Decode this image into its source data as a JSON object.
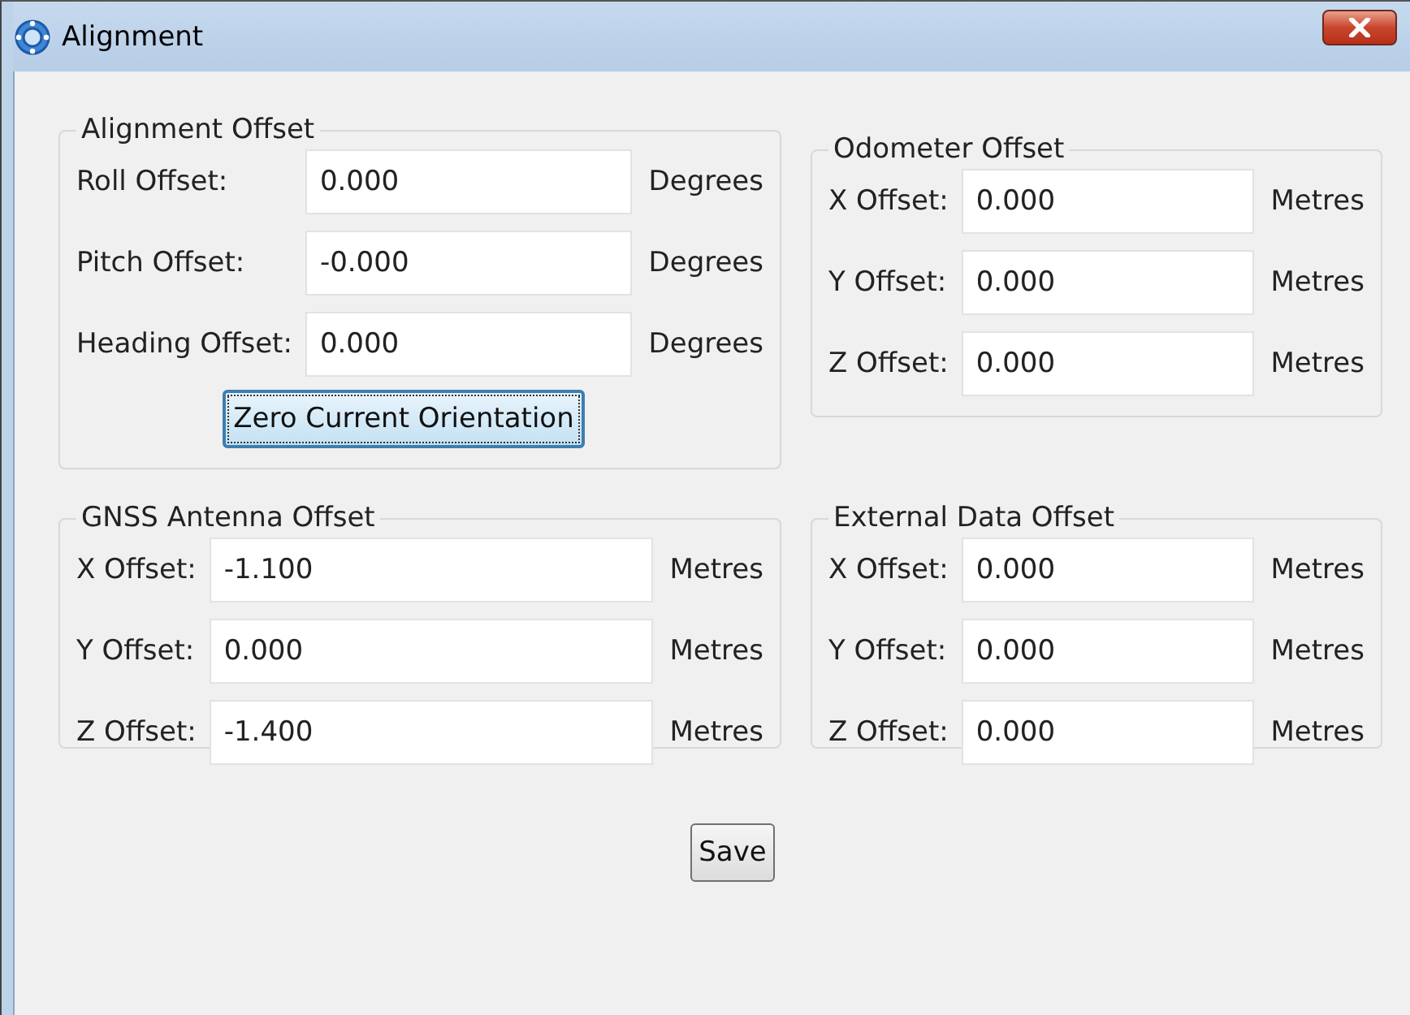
{
  "window": {
    "title": "Alignment"
  },
  "groups": [
    {
      "title": "Alignment Offset",
      "fields": [
        {
          "label": "Roll Offset:",
          "value": "0.000",
          "unit": "Degrees"
        },
        {
          "label": "Pitch Offset:",
          "value": "-0.000",
          "unit": "Degrees"
        },
        {
          "label": "Heading Offset:",
          "value": "0.000",
          "unit": "Degrees"
        }
      ],
      "button": {
        "label": "Zero Current Orientation",
        "focused": true
      }
    },
    {
      "title": "Odometer Offset",
      "fields": [
        {
          "label": "X Offset:",
          "value": "0.000",
          "unit": "Metres"
        },
        {
          "label": "Y Offset:",
          "value": "0.000",
          "unit": "Metres"
        },
        {
          "label": "Z Offset:",
          "value": "0.000",
          "unit": "Metres"
        }
      ]
    },
    {
      "title": "GNSS Antenna Offset",
      "fields": [
        {
          "label": "X Offset:",
          "value": "-1.100",
          "unit": "Metres"
        },
        {
          "label": "Y Offset:",
          "value": "0.000",
          "unit": "Metres"
        },
        {
          "label": "Z Offset:",
          "value": "-1.400",
          "unit": "Metres"
        }
      ]
    },
    {
      "title": "External Data Offset",
      "fields": [
        {
          "label": "X Offset:",
          "value": "0.000",
          "unit": "Metres"
        },
        {
          "label": "Y Offset:",
          "value": "0.000",
          "unit": "Metres"
        },
        {
          "label": "Z Offset:",
          "value": "0.000",
          "unit": "Metres"
        }
      ]
    }
  ],
  "save_button": {
    "label": "Save",
    "focused": false
  }
}
